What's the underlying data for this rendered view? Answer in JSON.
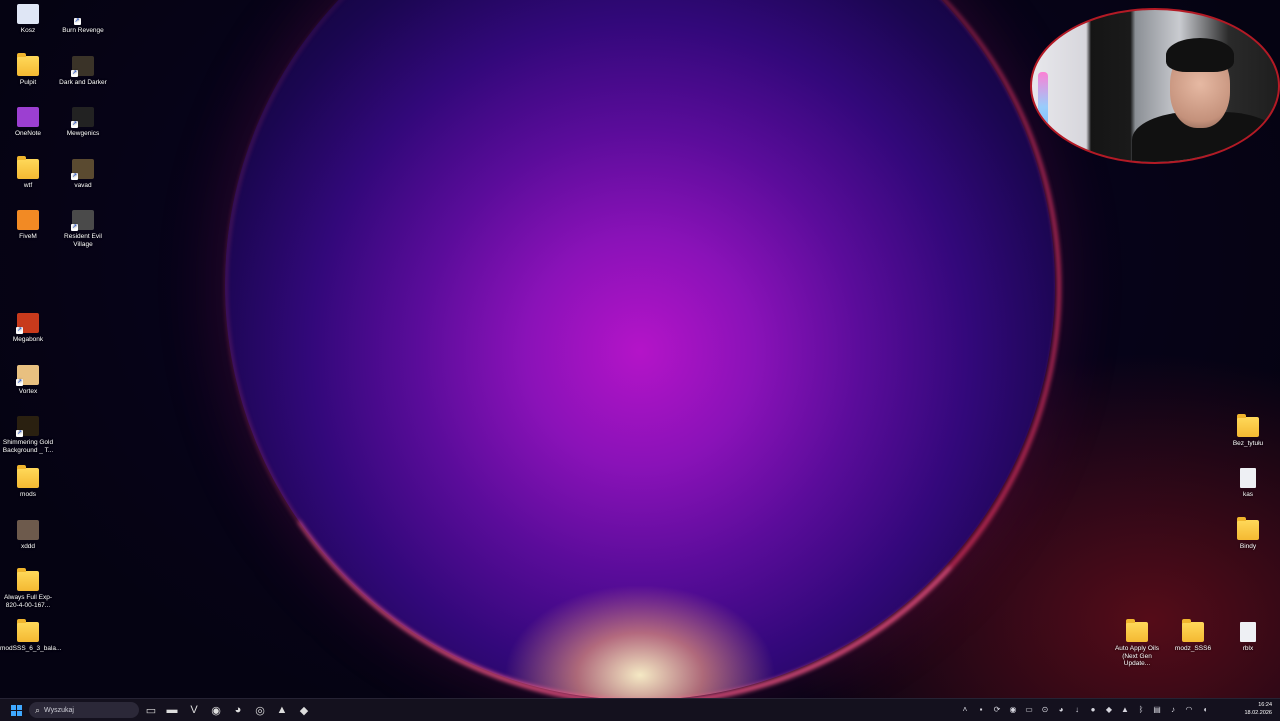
{
  "desktop": {
    "icons_left": [
      {
        "label": "Kosz",
        "icon": "recycle-bin-icon",
        "color": "#dfe6f5"
      },
      {
        "label": "Burn Revenge",
        "icon": "bottle-icon",
        "color": "#f2f2f2"
      },
      {
        "label": "Pulpit",
        "icon": "desktop-folder-icon",
        "color": "#ffd95a"
      },
      {
        "label": "Dark and Darker",
        "icon": "game-icon",
        "color": "#3a3328"
      },
      {
        "label": "OneNote",
        "icon": "onenote-icon",
        "color": "#9c3fd1"
      },
      {
        "label": "Mewgenics",
        "icon": "paw-icon",
        "color": "#222222"
      },
      {
        "label": "wtf",
        "icon": "folder-icon",
        "color": "#ffd95a"
      },
      {
        "label": "vavad",
        "icon": "app-icon",
        "color": "#5a4a30"
      },
      {
        "label": "FiveM",
        "icon": "fivem-icon",
        "color": "#f28a24"
      },
      {
        "label": "Resident Evil Village",
        "icon": "game-icon",
        "color": "#4a4a4a"
      },
      {
        "label": "Megabonk",
        "icon": "megabonk-icon",
        "color": "#c83a1c"
      },
      {
        "label": "Vortex",
        "icon": "vortex-icon",
        "color": "#e8c080"
      },
      {
        "label": "Shimmering Gold Background _ T...",
        "icon": "video-file-icon",
        "color": "#2a2010"
      },
      {
        "label": "mods",
        "icon": "folder-icon",
        "color": "#ffd95a"
      },
      {
        "label": "xddd",
        "icon": "image-file-icon",
        "color": "#6d5a4c"
      },
      {
        "label": "Always Full Exp-820-4-00-167...",
        "icon": "folder-icon",
        "color": "#ffd95a"
      },
      {
        "label": "modSSS_6_3_bala...",
        "icon": "folder-icon",
        "color": "#ffd95a"
      }
    ],
    "icons_right": [
      {
        "label": "Bez_tytułu",
        "icon": "folder-icon",
        "color": "#ffd95a"
      },
      {
        "label": "kas",
        "icon": "text-file-icon",
        "color": "#eef0f4"
      },
      {
        "label": "Bindy",
        "icon": "folder-icon",
        "color": "#ffd95a"
      },
      {
        "label": "Auto Apply Oils (Next Gen Update...",
        "icon": "folder-icon",
        "color": "#ffd95a"
      },
      {
        "label": "modz_SSS6",
        "icon": "folder-icon",
        "color": "#ffd95a"
      },
      {
        "label": "rblx",
        "icon": "text-file-icon",
        "color": "#eef0f4"
      }
    ]
  },
  "taskbar": {
    "search_placeholder": "Wyszukaj",
    "pinned_apps": [
      {
        "icon": "task-view-icon",
        "glyph": "▭"
      },
      {
        "icon": "file-explorer-icon",
        "glyph": "▬"
      },
      {
        "icon": "vivaldi-icon",
        "glyph": "V"
      },
      {
        "icon": "steam-icon",
        "glyph": "◉"
      },
      {
        "icon": "discord-icon",
        "glyph": "◕"
      },
      {
        "icon": "chrome-icon",
        "glyph": "◎"
      },
      {
        "icon": "media-app-icon",
        "glyph": "▲"
      },
      {
        "icon": "brave-icon",
        "glyph": "◆"
      }
    ],
    "tray_icons": [
      "chevron-icon",
      "nvidia-icon",
      "sync-icon",
      "steam-tray-icon",
      "battery-icon",
      "controller-icon",
      "discord-tray-icon",
      "download-icon",
      "record-icon",
      "app-tray-icon",
      "vivaldi-tray-icon",
      "bluetooth-icon",
      "network-icon",
      "microphone-icon",
      "wifi-icon",
      "volume-icon"
    ],
    "clock_time": "16:24",
    "clock_date": "18.02.2026"
  }
}
